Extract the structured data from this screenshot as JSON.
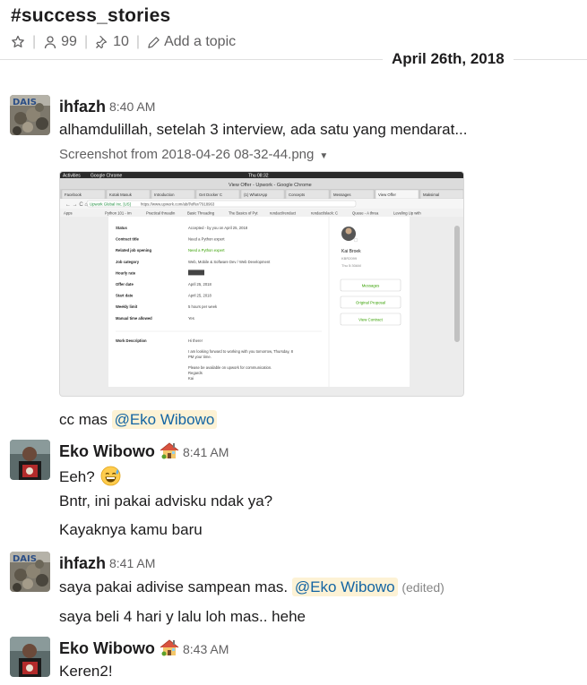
{
  "channel": {
    "title": "#success_stories",
    "members": "99",
    "pins": "10",
    "topic_link": "Add a topic"
  },
  "date_divider": "April 26th, 2018",
  "messages": [
    {
      "author": "ihfazh",
      "time": "8:40 AM",
      "text": "alhamdulillah, setelah 3 interview, ada satu yang mendarat...",
      "file_title": "Screenshot from 2018-04-26 08-32-44.png"
    },
    {
      "line_prefix": "cc mas ",
      "mention": "@Eko Wibowo"
    },
    {
      "author": "Eko Wibowo",
      "time": "8:41 AM",
      "lines": [
        "Eeh?",
        "Bntr, ini pakai advisku ndak ya?",
        "Kayaknya kamu baru"
      ]
    },
    {
      "author": "ihfazh",
      "time": "8:41 AM",
      "line1_prefix": "saya pakai adivise sampean mas. ",
      "mention": "@Eko Wibowo",
      "edited": "(edited)",
      "line2": "saya beli 4 hari y lalu loh mas.. hehe"
    },
    {
      "author": "Eko Wibowo",
      "time": "8:43 AM",
      "text": "Keren2!"
    }
  ],
  "screenshot": {
    "topbar": {
      "activities": "Activities",
      "app": "Google Chrome",
      "clock": "Thu 08:32"
    },
    "window_title": "View Offer - Upwork - Google Chrome",
    "tabs": [
      "Facebook",
      "Kotak Masuk",
      "Introduction",
      "Get Docker C",
      "(1) WhatsApp",
      "Concepts",
      "Messages",
      "View Offer",
      "Maksimal"
    ],
    "url_host": "Upwork Global Inc. [US]",
    "url": "https://www.upwork.com/ab/f/offer/7918963",
    "bookmarks": [
      "Apps",
      "Python 101 - Im",
      "Practical threadin",
      "Basic Threading",
      "The Basics of Pyt",
      "rendact/rendact",
      "rendact/slack: C",
      "Queue - A threa",
      "Leveling Up with"
    ],
    "rows": [
      {
        "label": "Status",
        "value": "Accepted - by you on April 25, 2018"
      },
      {
        "label": "Contract title",
        "value": "Need a Python expert"
      },
      {
        "label": "Related job opening",
        "value": "Need a Python expert"
      },
      {
        "label": "Job category",
        "value": "Web, Mobile & Software Dev / Web Development"
      },
      {
        "label": "Hourly rate",
        "value": ""
      },
      {
        "label": "Offer date",
        "value": "April 25, 2018"
      },
      {
        "label": "Start date",
        "value": "April 25, 2018"
      },
      {
        "label": "Weekly limit",
        "value": "5 hours per week"
      },
      {
        "label": "Manual time allowed",
        "value": "Yes"
      }
    ],
    "work_desc_label": "Work Description",
    "work_desc": [
      "Hi there!",
      "I am looking forward to working with you tomorrow, Thursday, 8",
      "PM your time.",
      "Please be available on upwork for communication.",
      "Regards",
      "Kai"
    ],
    "client_name": "Kai Broek",
    "client_id": "KBR2099",
    "client_time": "Thu 5:30AM",
    "buttons": [
      "Messages",
      "Original Proposal",
      "View Contract"
    ],
    "colors": {
      "accent_green": "#37a000",
      "topbar": "#2b2b2b"
    }
  },
  "colors": {
    "mention_bg": "#fdf2d5",
    "mention_text": "#1264a3"
  }
}
